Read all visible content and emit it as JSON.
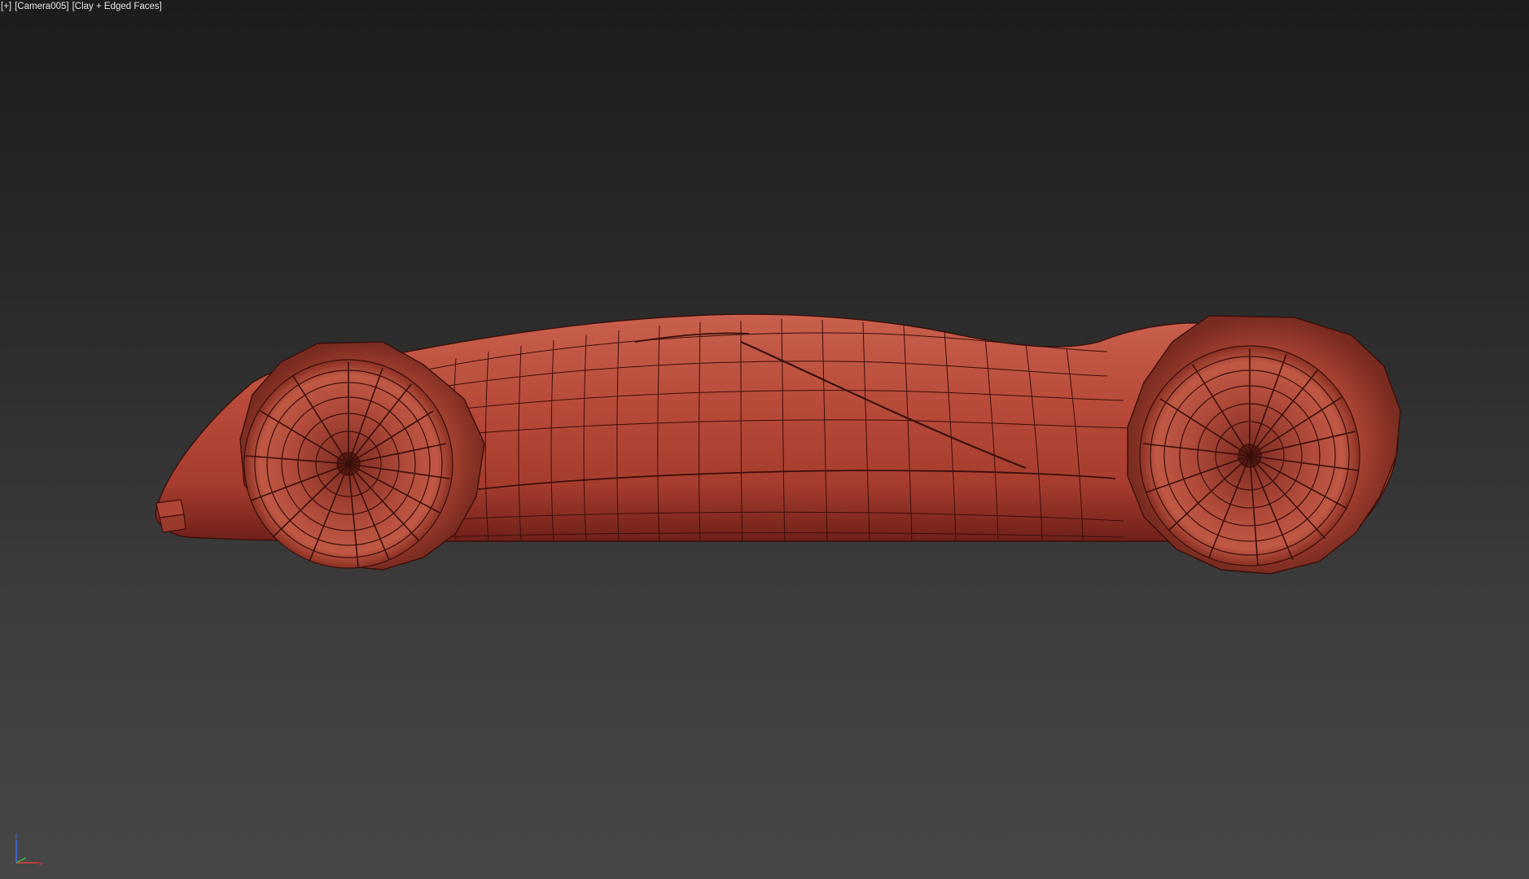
{
  "viewport": {
    "menu_label": "[+]",
    "camera_label": "[Camera005]",
    "shading_label": "[Clay + Edged Faces]"
  },
  "axis_gizmo": {
    "z_label": "z",
    "x_label": "x",
    "z_color": "#3a6df0",
    "x_color": "#e03a3a",
    "y_color": "#3ac43a"
  },
  "model": {
    "color": "#b84a3a",
    "wire_color": "#3a0f0a"
  }
}
